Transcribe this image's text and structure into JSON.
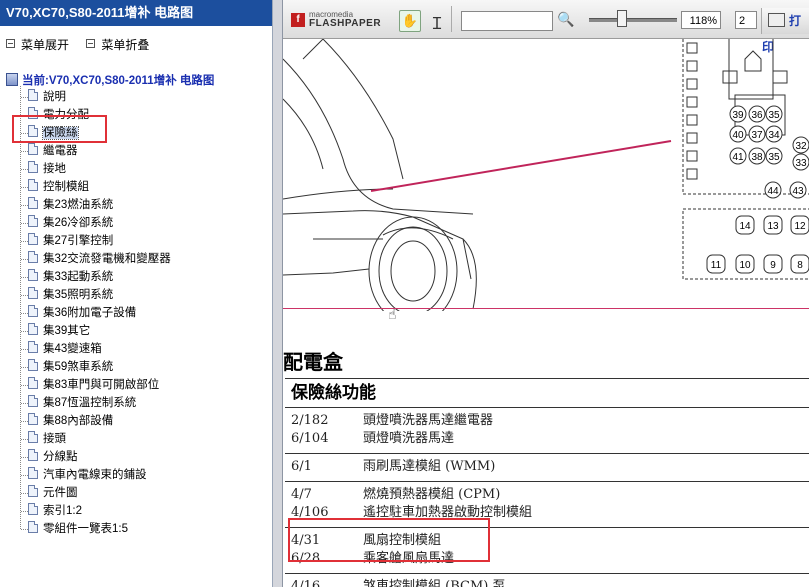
{
  "sidebar": {
    "title": "V70,XC70,S80-2011增补 电路图",
    "expand_label": "菜单展开",
    "collapse_label": "菜单折叠",
    "root_label": "当前:V70,XC70,S80-2011增补 电路图",
    "items": [
      {
        "label": "說明"
      },
      {
        "label": "電力分配"
      },
      {
        "label": "保險絲",
        "selected": true
      },
      {
        "label": "繼電器"
      },
      {
        "label": "接地"
      },
      {
        "label": "控制模組"
      },
      {
        "label": "集23燃油系統"
      },
      {
        "label": "集26冷卻系統"
      },
      {
        "label": "集27引擎控制"
      },
      {
        "label": "集32交流發電機和變壓器"
      },
      {
        "label": "集33起動系統"
      },
      {
        "label": "集35照明系統"
      },
      {
        "label": "集36附加電子設備"
      },
      {
        "label": "集39其它"
      },
      {
        "label": "集43變速箱"
      },
      {
        "label": "集59煞車系統"
      },
      {
        "label": "集83車門與可開啟部位"
      },
      {
        "label": "集87恆溫控制系統"
      },
      {
        "label": "集88內部設備"
      },
      {
        "label": "接頭"
      },
      {
        "label": "分線點"
      },
      {
        "label": "汽車內電線束的鋪設"
      },
      {
        "label": "元件圖"
      },
      {
        "label": "索引1:2"
      },
      {
        "label": "零組件一覽表1:5"
      }
    ]
  },
  "toolbar": {
    "logo_line1": "macromedia",
    "logo_line2": "FLASHPAPER",
    "zoom": "118%",
    "page": "2",
    "print_label": "打印",
    "icons": [
      "hand-icon",
      "text-cursor-icon",
      "search-icon",
      "print-icon"
    ]
  },
  "document": {
    "fuse_numbers": {
      "top": [
        "39",
        "36",
        "35",
        "40",
        "37",
        "34",
        "32",
        "41",
        "38",
        "35",
        "33",
        "44",
        "43"
      ],
      "bottom_upper": [
        "14",
        "13",
        "12"
      ],
      "bottom_lower": [
        "11",
        "10",
        "9",
        "8"
      ]
    },
    "section_title": "配電盒",
    "table_header": "保險絲功能",
    "groups": [
      [
        {
          "code": "2/182",
          "desc": "頭燈噴洗器馬達繼電器"
        },
        {
          "code": "6/104",
          "desc": "頭燈噴洗器馬達"
        }
      ],
      [
        {
          "code": "6/1",
          "desc": "雨刷馬達模組 (WMM)"
        }
      ],
      [
        {
          "code": "4/7",
          "desc": "燃燒預熱器模組 (CPM)"
        },
        {
          "code": "4/106",
          "desc": "遙控駐車加熱器啟動控制模組"
        }
      ],
      [
        {
          "code": "4/31",
          "desc": "風扇控制模組"
        },
        {
          "code": "6/28",
          "desc": "乘客艙風扇馬達"
        }
      ],
      [
        {
          "code": "4/16",
          "desc": "煞車控制模組 (BCM),泵"
        }
      ]
    ]
  },
  "colors": {
    "sidebar_title_bg": "#1c4f9e",
    "highlight_box": "#e03037",
    "root_text": "#1a2fb0",
    "divider_pink": "#cc3366"
  }
}
